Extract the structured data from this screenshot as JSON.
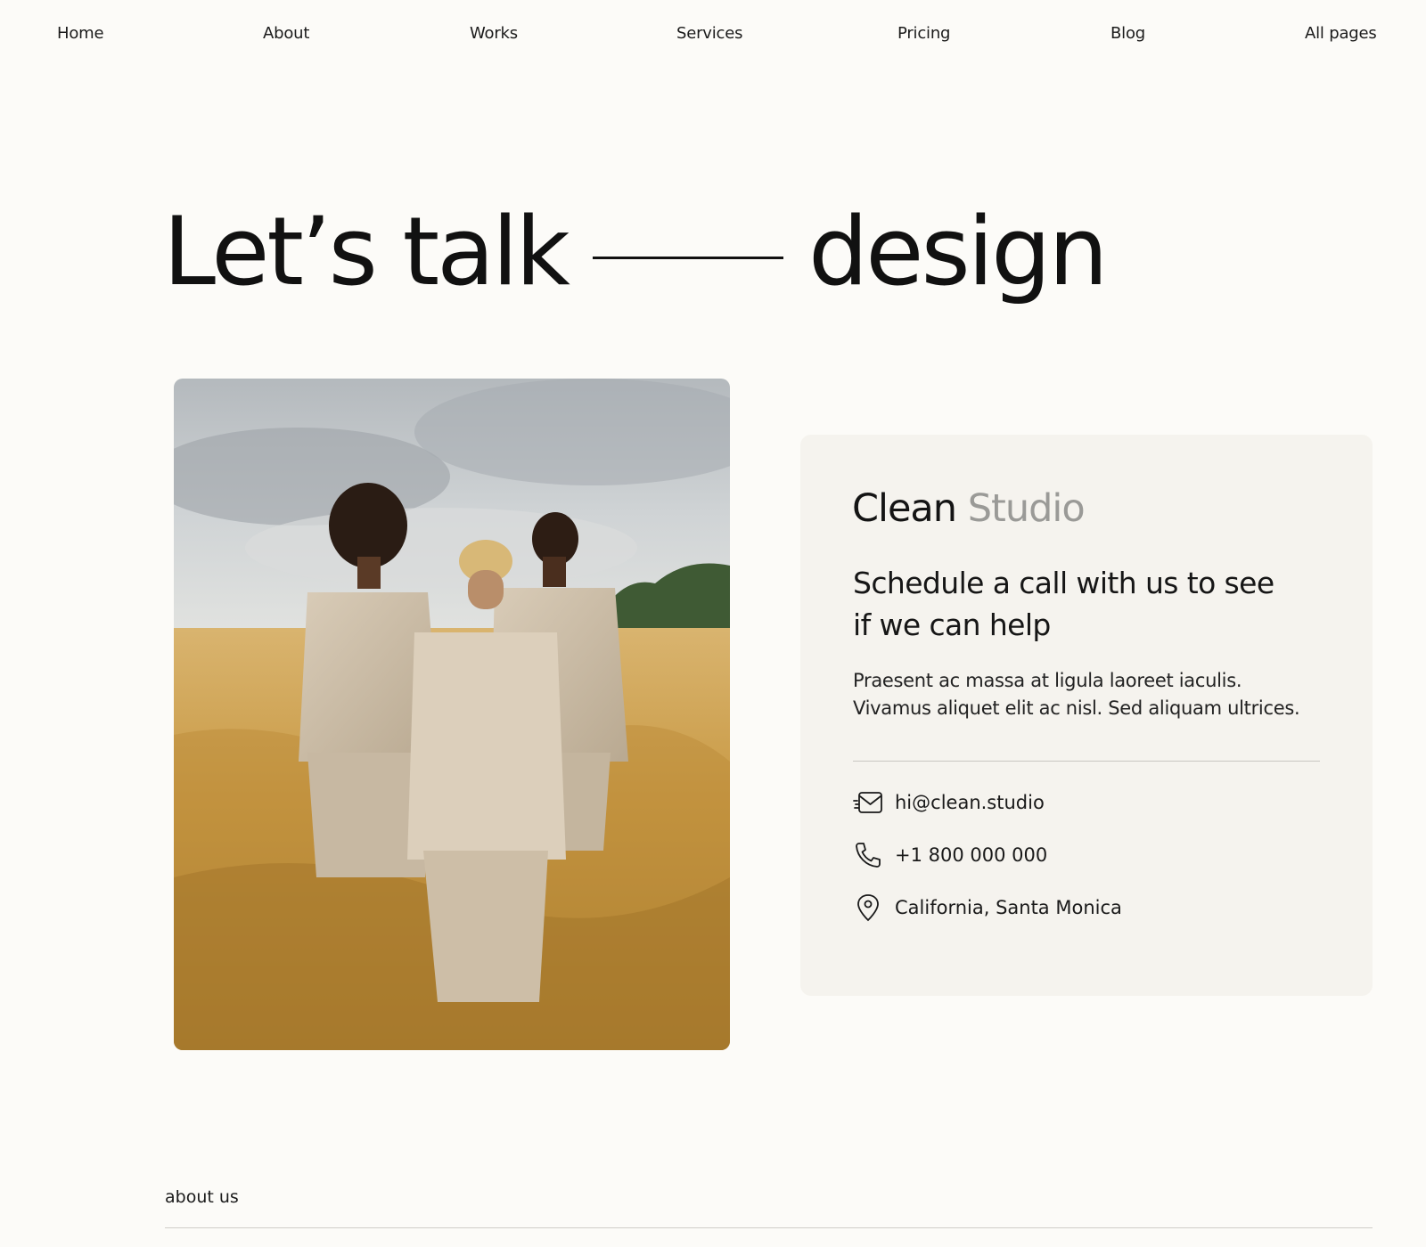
{
  "nav": {
    "items": [
      {
        "label": "Home"
      },
      {
        "label": "About"
      },
      {
        "label": "Works"
      },
      {
        "label": "Services"
      },
      {
        "label": "Pricing"
      },
      {
        "label": "Blog"
      },
      {
        "label": "All pages"
      }
    ]
  },
  "hero": {
    "word_left": "Let’s talk",
    "word_right": "design"
  },
  "photo": {
    "subject": "three people in beige suits standing in a wheat field under a cloudy sky"
  },
  "card": {
    "brand_primary": "Clean",
    "brand_secondary": "Studio",
    "heading": "Schedule a call with us to see if we can help",
    "text": "Praesent ac massa at ligula laoreet iaculis. Vivamus aliquet elit ac nisl. Sed aliquam ultrices.",
    "contacts": [
      {
        "icon": "mail-icon",
        "value": "hi@clean.studio"
      },
      {
        "icon": "phone-icon",
        "value": "+1 800 000 000"
      },
      {
        "icon": "map-pin-icon",
        "value": "California, Santa Monica"
      }
    ]
  },
  "about": {
    "label": "about us"
  },
  "colors": {
    "background": "#fcfbf8",
    "card_background": "#f5f3ee",
    "text": "#141414",
    "muted": "#9a9a97"
  }
}
